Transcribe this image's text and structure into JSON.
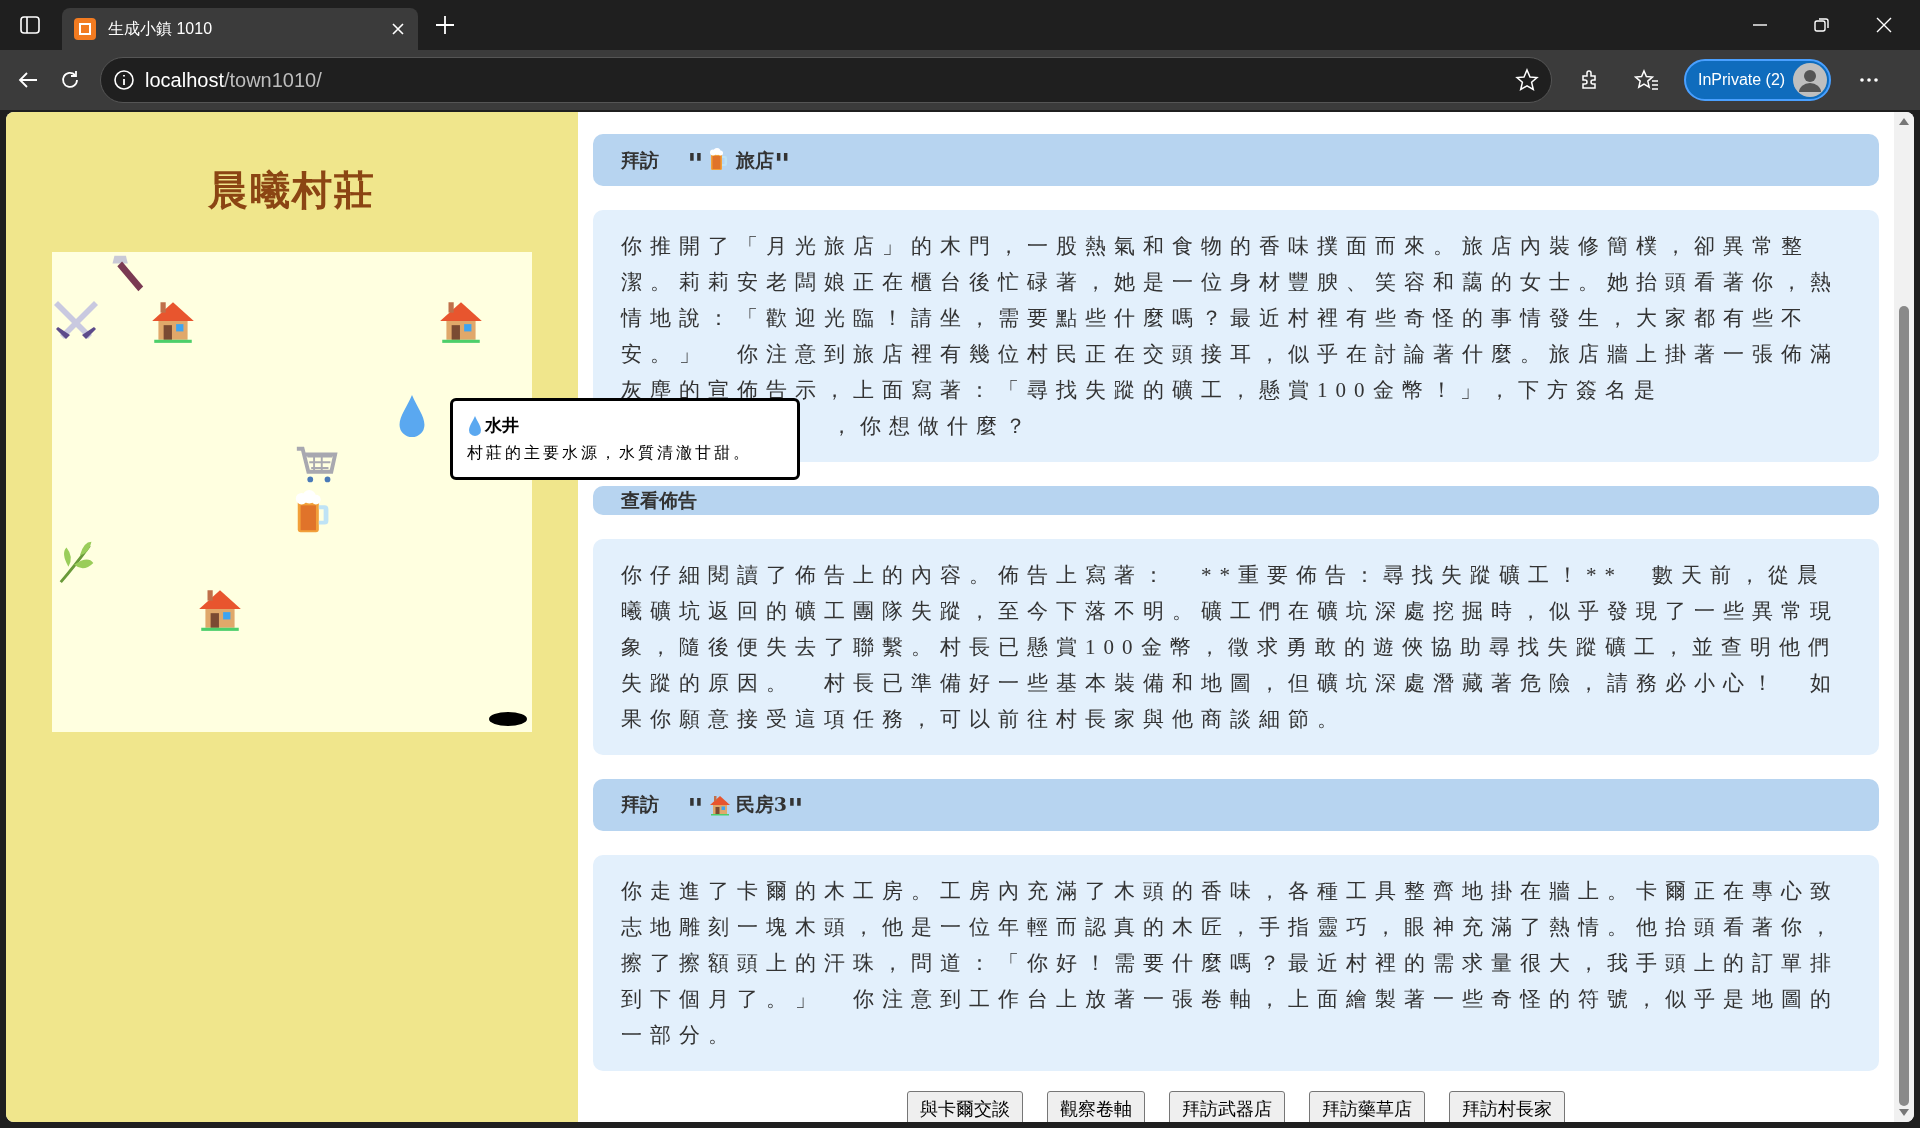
{
  "browser": {
    "tab_title": "生成小鎮 1010",
    "url_host": "localhost",
    "url_path": "/town1010/",
    "profile": "InPrivate (2)"
  },
  "sidebar": {
    "title": "晨曦村莊"
  },
  "tooltip": {
    "kind": "drop",
    "title": "水井",
    "text": "村莊的主要水源，水質清澈甘甜。"
  },
  "log": [
    {
      "heading": {
        "verb": "拜訪",
        "open": "\"",
        "kind": "beer",
        "name": "旅店",
        "close": "\""
      },
      "lines": [
        "你推開了「月光旅店」的木門，一股熱氣和食物的香味撲面而來。旅店內裝修簡樸，卻異常整潔。莉莉安老闆娘正在櫃台後忙碌著，她是一位身材豐腴、笑容和藹的女士。她抬頭看著你，熱情地說：「歡迎光臨！請坐，需要點些什麼嗎？最近村裡有些奇怪的事情發生，大家都有些不安。」　你注意到旅店裡有幾位村民正在交頭接耳，似乎在討論著什麼。旅店牆上掛著一張佈滿灰塵的宣佈告示，上面寫著：「尋找失蹤的礦工，懸賞100金幣！」，下方簽名是",
        "，你想做什麼？"
      ]
    },
    {
      "heading": {
        "verb": "查看佈告"
      },
      "lines": [
        "你仔細閱讀了佈告上的內容。佈告上寫著：　**重要佈告：尋找失蹤礦工！**　數天前，從晨曦礦坑返回的礦工團隊失蹤，至今下落不明。礦工們在礦坑深處挖掘時，似乎發現了一些異常現象，隨後便失去了聯繫。村長已懸賞100金幣，徵求勇敢的遊俠協助尋找失蹤礦工，並查明他們失蹤的原因。　村長已準備好一些基本裝備和地圖，但礦坑深處潛藏著危險，請務必小心！　如果你願意接受這項任務，可以前往村長家與他商談細節。"
      ]
    },
    {
      "heading": {
        "verb": "拜訪",
        "open": "\"",
        "kind": "house",
        "name": "民房3",
        "close": "\""
      },
      "lines": [
        "你走進了卡爾的木工房。工房內充滿了木頭的香味，各種工具整齊地掛在牆上。卡爾正在專心致志地雕刻一塊木頭，他是一位年輕而認真的木匠，手指靈巧，眼神充滿了熱情。他抬頭看著你，擦了擦額頭上的汗珠，問道：「你好！需要什麼嗎？最近村裡的需求量很大，我手頭上的訂單排到下個月了。」　你注意到工作台上放著一張卷軸，上面繪製著一些奇怪的符號，似乎是地圖的一部分。"
      ]
    }
  ],
  "actions": [
    "與卡爾交談",
    "觀察卷軸",
    "拜訪武器店",
    "拜訪藥草店",
    "拜訪村長家"
  ]
}
